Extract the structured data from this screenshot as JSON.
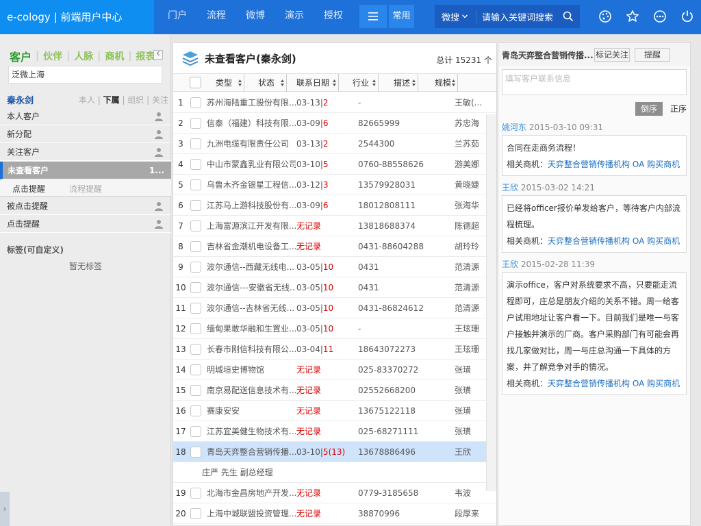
{
  "header": {
    "brand": "e-cology | 前端用户中心",
    "nav": [
      "门户",
      "流程",
      "微博",
      "演示",
      "授权"
    ],
    "common_label": "常用",
    "search_scope": "微搜",
    "search_placeholder": "请输入关键词搜索",
    "icons": [
      "menu-icon",
      "search-icon",
      "palette-icon",
      "star-icon",
      "more-icon",
      "power-icon"
    ]
  },
  "left": {
    "tabs": [
      "客户",
      "伙伴",
      "人脉",
      "商机",
      "报表"
    ],
    "search_value": "泛微上海",
    "user_name": "秦永剑",
    "scope": [
      "本人",
      "下属",
      "组织",
      "关注"
    ],
    "items_top": [
      "本人客户",
      "新分配",
      "关注客户"
    ],
    "active_item": "未查看客户",
    "active_count": "1...",
    "subtabs": [
      "点击提醒",
      "流程提醒"
    ],
    "items_bottom": [
      "被点击提醒",
      "点击提醒"
    ],
    "tags_title": "标签(可自定义)",
    "no_tags": "暂无标签",
    "expander": "›"
  },
  "center": {
    "title": "未查看客户(秦永剑)",
    "total": "总计 15231 个",
    "columns": [
      "类型",
      "状态",
      "联系日期",
      "行业",
      "描述",
      "规模"
    ],
    "rows": [
      {
        "num": "1",
        "name": "苏州海陆重工股份有限...",
        "date": "03-13|",
        "dnum": "2",
        "tel": "-",
        "owner": "王敏(..."
      },
      {
        "num": "2",
        "name": "信泰（福建）科技有限...",
        "date": "03-09|",
        "dnum": "6",
        "tel": "82665999",
        "owner": "苏忠海"
      },
      {
        "num": "3",
        "name": "九洲电缆有限责任公司",
        "date": "03-13|",
        "dnum": "2",
        "tel": "2544300",
        "owner": "兰苏茹"
      },
      {
        "num": "4",
        "name": "中山市蒙鑫乳业有限公司",
        "date": "03-10|",
        "dnum": "5",
        "tel": "0760-88558626",
        "owner": "游美娜"
      },
      {
        "num": "5",
        "name": "乌鲁木齐金银星工程信...",
        "date": "03-12|",
        "dnum": "3",
        "tel": "13579928031",
        "owner": "黄晓婕"
      },
      {
        "num": "6",
        "name": "江苏马上游科技股份有...",
        "date": "03-09|",
        "dnum": "6",
        "tel": "18012808111",
        "owner": "张海华"
      },
      {
        "num": "7",
        "name": "上海富源滨江开发有限...",
        "date": "",
        "dnum": "",
        "nr": "无记录",
        "tel": "13818688374",
        "owner": "陈德超"
      },
      {
        "num": "8",
        "name": "吉林省金潮机电设备工...",
        "date": "",
        "dnum": "",
        "nr": "无记录",
        "tel": "0431-88604288",
        "owner": "胡玲玲"
      },
      {
        "num": "9",
        "name": "波尔通信--西藏无线电...",
        "date": "03-05|",
        "dnum": "10",
        "tel": "0431",
        "owner": "范清源"
      },
      {
        "num": "10",
        "name": "波尔通信---安徽省无线...",
        "date": "03-05|",
        "dnum": "10",
        "tel": "0431",
        "owner": "范清源"
      },
      {
        "num": "11",
        "name": "波尔通信--吉林省无线...",
        "date": "03-05|",
        "dnum": "10",
        "tel": "0431-86824612",
        "owner": "范清源"
      },
      {
        "num": "12",
        "name": "缅甸果敢华融和生置业...",
        "date": "03-05|",
        "dnum": "10",
        "tel": "-",
        "owner": "王玹珊"
      },
      {
        "num": "13",
        "name": "长春市刚信科技有限公...",
        "date": "03-04|",
        "dnum": "11",
        "tel": "18643072273",
        "owner": "王玹珊"
      },
      {
        "num": "14",
        "name": "明城垣史博物馆",
        "date": "",
        "dnum": "",
        "nr": "无记录",
        "tel": "025-83370272",
        "owner": "张璜"
      },
      {
        "num": "15",
        "name": "南京易配送信息技术有...",
        "date": "",
        "dnum": "",
        "nr": "无记录",
        "tel": "02552668200",
        "owner": "张璜"
      },
      {
        "num": "16",
        "name": "赛康安安",
        "date": "",
        "dnum": "",
        "nr": "无记录",
        "tel": "13675122118",
        "owner": "张璜"
      },
      {
        "num": "17",
        "name": "江苏宜美健生物技术有...",
        "date": "",
        "dnum": "",
        "nr": "无记录",
        "tel": "025-68271111",
        "owner": "张璜"
      },
      {
        "num": "18",
        "name": "青岛天弈整合营销传播...",
        "date": "03-10|",
        "dnum": "5",
        "dsuffix": "(13)",
        "tel": "13678886496",
        "owner": "王欣"
      },
      {
        "num": "19",
        "name": "北海市金昌房地产开发...",
        "date": "",
        "dnum": "",
        "nr": "无记录",
        "tel": "0779-3185658",
        "owner": "韦波"
      },
      {
        "num": "20",
        "name": "上海中城联盟投资管理...",
        "date": "",
        "dnum": "",
        "nr": "无记录",
        "tel": "38870996",
        "owner": "段厚来"
      }
    ],
    "contact_line": "庄严 先生  副总经理"
  },
  "right": {
    "title": "青岛天弈整合营销传播...",
    "btn_mark": "标记关注",
    "btn_remind": "提醒",
    "input_placeholder": "填写客户联系信息",
    "order_desc": "倒序",
    "order_asc": "正序",
    "feeds": [
      {
        "who": "姚河东",
        "time": "2015-03-10 09:31",
        "text": "合同在走商务流程！",
        "rel_label": "相关商机：",
        "rel_link": "天弈整合营销传播机构 OA 购买商机"
      },
      {
        "who": "王欣",
        "time": "2015-03-02 14:21",
        "text": "已经将officer报价单发给客户，等待客户内部流程梳理。",
        "rel_label": "相关商机：",
        "rel_link": "天弈整合营销传播机构 OA 购买商机"
      },
      {
        "who": "王欣",
        "time": "2015-02-28 11:39",
        "text": "演示office，客户对系统要求不高，只要能走流程即可，庄总是朋友介绍的关系不错。周一给客户试用地址让客户看一下。目前我们是唯一与客户接触并演示的厂商。客户采购部门有可能会再找几家做对比，周一与庄总沟通一下具体的方案，并了解竞争对手的情况。",
        "rel_label": "相关商机：",
        "rel_link": "天弈整合营销传播机构 OA 购买商机"
      }
    ]
  },
  "colors": {
    "topbar": "#1e71d9",
    "brand_bg": "#0f8ef2",
    "customer_green": "#2e9d2e",
    "red": "#dd0000",
    "link": "#1e6fc2"
  }
}
